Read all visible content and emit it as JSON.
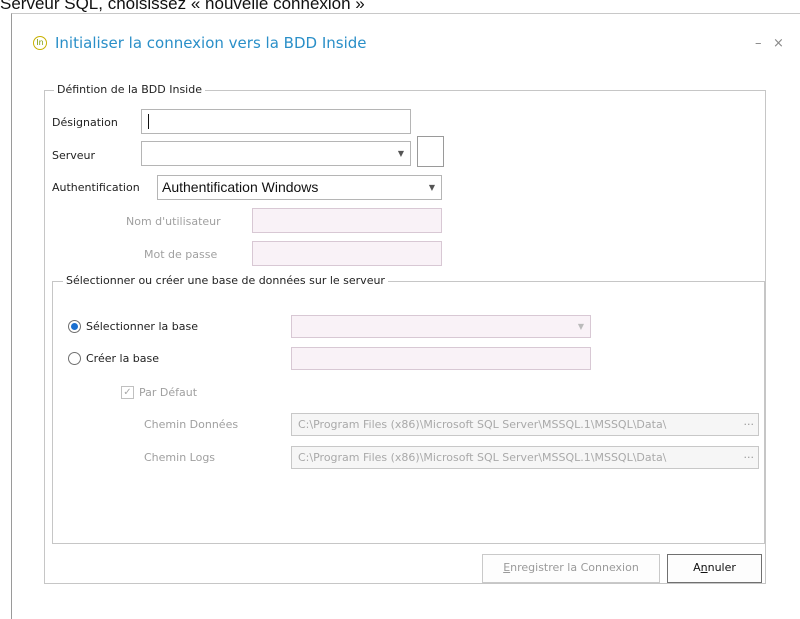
{
  "caption": "Serveur SQL, choisissez « nouvelle connexion »",
  "window": {
    "title": "Initialiser la connexion vers la BDD Inside",
    "minimize": "–",
    "close": "×"
  },
  "group_bdd": {
    "legend": "Défintion de la BDD Inside",
    "designation_label": "Désignation",
    "designation_value": "",
    "serveur_label": "Serveur",
    "serveur_value": "",
    "auth_label": "Authentification",
    "auth_value": "Authentification Windows",
    "user_label": "Nom d'utilisateur",
    "password_label": "Mot de passe"
  },
  "group_base": {
    "legend": "Sélectionner ou créer une base de données sur le serveur",
    "select_label": "Sélectionner la base",
    "create_label": "Créer la base",
    "default_label": "Par Défaut",
    "data_path_label": "Chemin Données",
    "data_path_value": "C:\\Program Files (x86)\\Microsoft SQL Server\\MSSQL.1\\MSSQL\\Data\\",
    "logs_path_label": "Chemin Logs",
    "logs_path_value": "C:\\Program Files (x86)\\Microsoft SQL Server\\MSSQL.1\\MSSQL\\Data\\",
    "browse": "···"
  },
  "buttons": {
    "save_mnemonic": "E",
    "save_rest": "nregistrer la Connexion",
    "cancel_pre": "A",
    "cancel_mnemonic": "n",
    "cancel_rest": "nuler"
  }
}
